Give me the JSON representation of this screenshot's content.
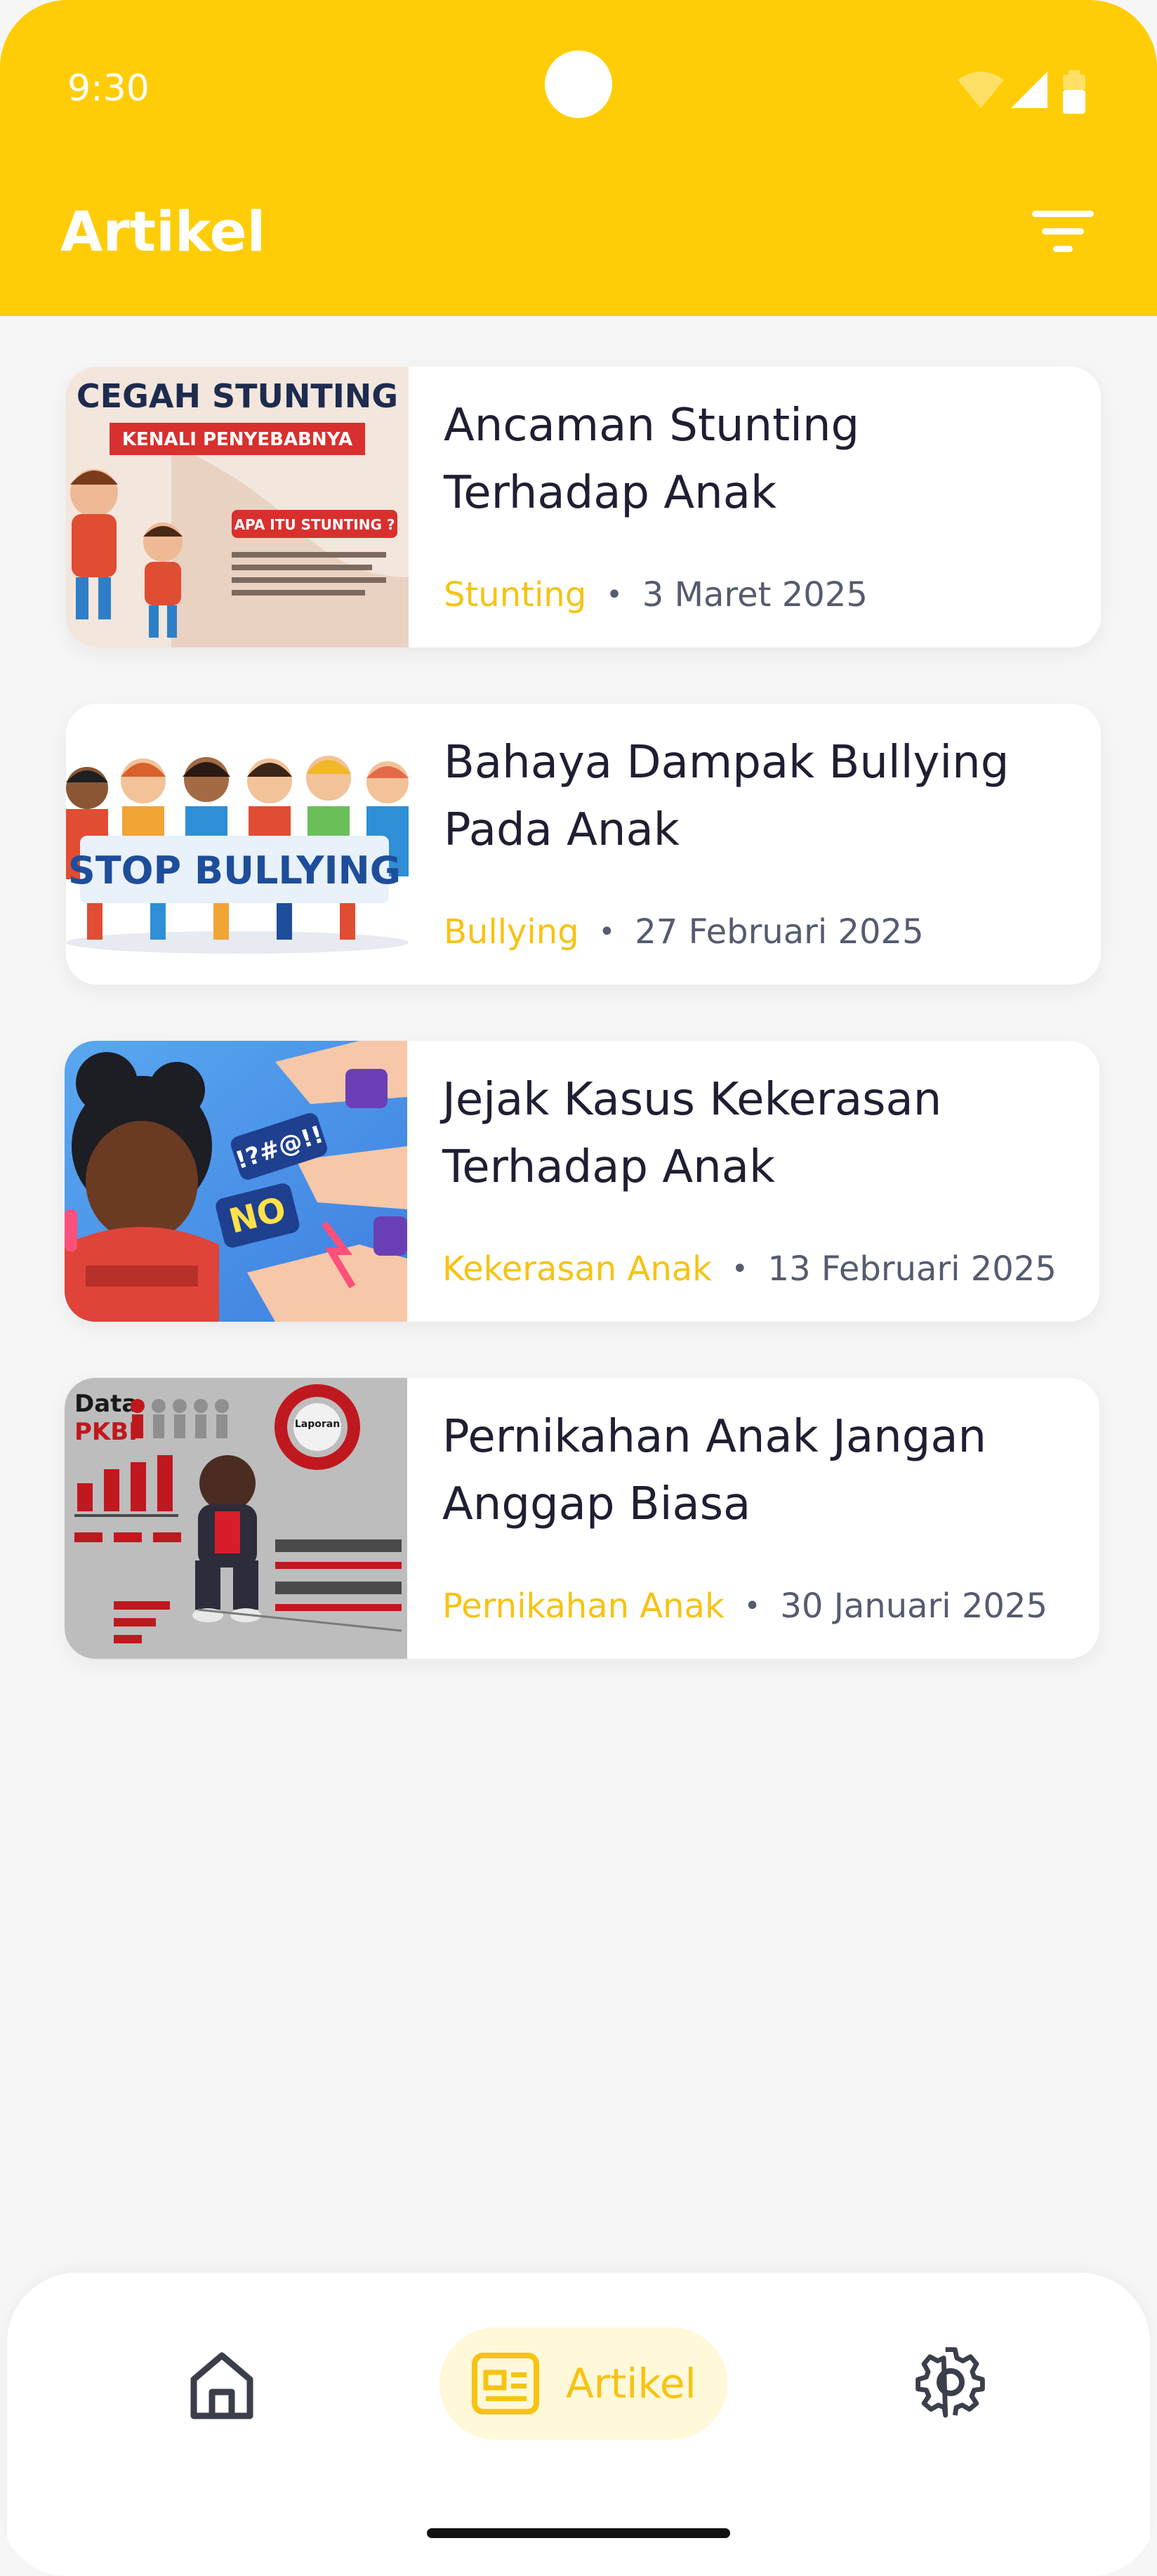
{
  "status_bar": {
    "time": "9:30"
  },
  "header": {
    "title": "Artikel",
    "filter_icon": "filter-icon"
  },
  "colors": {
    "header": "#ffcd07",
    "accent": "#f7c313",
    "title_text": "#1f1f33",
    "meta_text": "#555c70",
    "background": "#f6f6f6"
  },
  "articles": [
    {
      "title_line1": "Ancaman Stunting",
      "title_line2": "Terhadap Anak",
      "category": "Stunting",
      "date": "3 Maret 2025",
      "thumb_heading": "CEGAH STUNTING",
      "thumb_banner": "KENALI PENYEBABNYA",
      "thumb_question": "APA ITU STUNTING ?"
    },
    {
      "title_line1": "Bahaya Dampak Bullying",
      "title_line2": "Pada Anak",
      "category": "Bullying",
      "date": "27 Februari 2025",
      "thumb_sign": "STOP BULLYING"
    },
    {
      "title_line1": "Jejak Kasus Kekerasan",
      "title_line2": "Terhadap Anak",
      "category": "Kekerasan Anak",
      "date": "13 Februari 2025",
      "thumb_word1": "NO",
      "thumb_word2": "!?#@!!"
    },
    {
      "title_line1": "Pernikahan Anak Jangan",
      "title_line2": "Anggap Biasa",
      "category": "Pernikahan Anak",
      "date": "30 Januari 2025",
      "thumb_heading1": "Data",
      "thumb_heading2": "PKBI",
      "thumb_badge": "Laporan"
    }
  ],
  "bottom_nav": {
    "home_icon": "home-icon",
    "articles_label": "Artikel",
    "articles_icon": "newspaper-icon",
    "settings_icon": "gear-icon"
  }
}
